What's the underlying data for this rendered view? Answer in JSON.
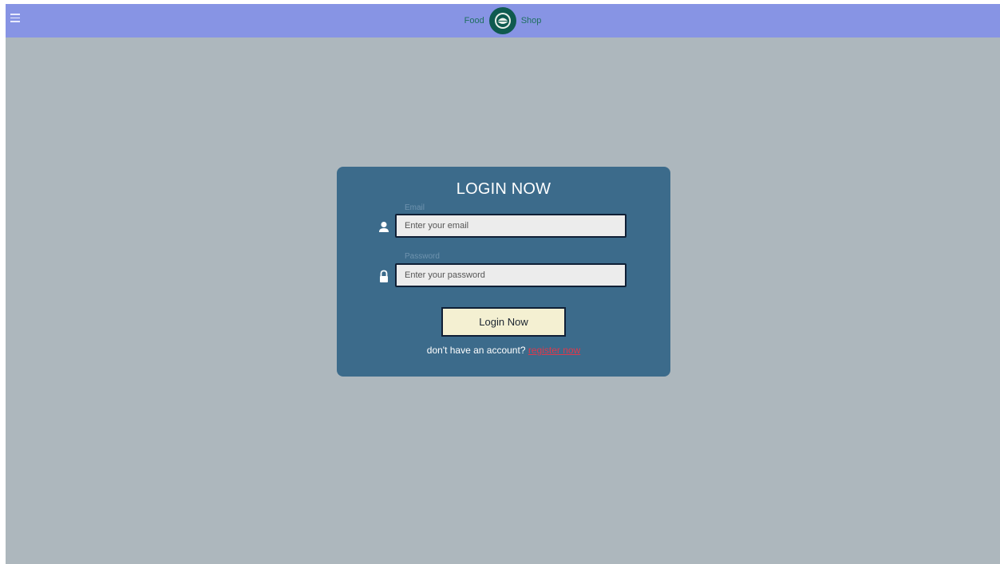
{
  "header": {
    "brand_left": "Food",
    "brand_right": "Shop",
    "menu_icon": "hamburger-menu-icon",
    "logo_icon": "food-bowl-logo"
  },
  "login": {
    "title": "LOGIN NOW",
    "email": {
      "label": "Email",
      "placeholder": "Enter your email",
      "value": "",
      "icon": "user-icon"
    },
    "password": {
      "label": "Password",
      "placeholder": "Enter your password",
      "value": "",
      "icon": "lock-icon"
    },
    "submit_label": "Login Now",
    "register_prompt": "don't have an account?",
    "register_link": "register now"
  },
  "colors": {
    "page_bg": "#adb7bd",
    "header_bg": "#8794e4",
    "card_bg": "#3c6b8b",
    "button_bg": "#f4f0d2",
    "link": "#e0384b"
  }
}
